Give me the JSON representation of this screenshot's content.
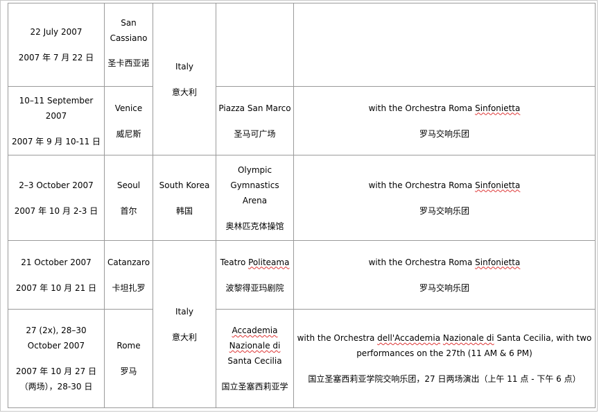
{
  "rows": [
    {
      "date_en": "22 July 2007",
      "date_zh": "2007 年 7 月 22 日",
      "city_en": "San Cassiano",
      "city_zh": "圣卡西亚诺",
      "venue_en": "",
      "venue_zh": "",
      "note_en": "",
      "note_zh": ""
    },
    {
      "date_en": "10–11 September 2007",
      "date_zh": "2007 年 9 月 10-11 日",
      "city_en": "Venice",
      "city_zh": "威尼斯",
      "venue_en": "Piazza San Marco",
      "venue_zh": "圣马可广场",
      "note_en_pre": "with the Orchestra Roma ",
      "note_en_sq": "Sinfonietta",
      "note_zh": "罗马交响乐团"
    },
    {
      "date_en": "2–3 October 2007",
      "date_zh": "2007 年 10 月 2-3 日",
      "city_en": "Seoul",
      "city_zh": "首尔",
      "venue_en": "Olympic Gymnastics Arena",
      "venue_zh": "奥林匹克体操馆",
      "note_en_pre": "with the Orchestra Roma ",
      "note_en_sq": "Sinfonietta",
      "note_zh": "罗马交响乐团"
    },
    {
      "date_en": "21 October 2007",
      "date_zh": "2007 年 10 月 21 日",
      "city_en": "Catanzaro",
      "city_zh": "卡坦扎罗",
      "venue_en_pre": "Teatro ",
      "venue_en_sq": "Politeama",
      "venue_zh": "波黎得亚玛剧院",
      "note_en_pre": "with the Orchestra Roma ",
      "note_en_sq": "Sinfonietta",
      "note_zh": "罗马交响乐团"
    },
    {
      "date_en": "27 (2x), 28–30 October 2007",
      "date_zh": "2007 年 10 月 27 日（两场），28-30 日",
      "city_en": "Rome",
      "city_zh": "罗马",
      "venue_en_sq1": "Accademia",
      "venue_en_sq2": "Nazionale di",
      "venue_en_post": " Santa Cecilia",
      "venue_zh": "国立圣塞西莉亚学",
      "note_en_pre": "with the Orchestra ",
      "note_en_sq1": "dell'Accademia",
      "note_en_mid1": " ",
      "note_en_sq2": "Nazionale di",
      "note_en_post": " Santa Cecilia, with two performances on the 27th (11 AM & 6 PM)",
      "note_zh": "国立圣塞西莉亚学院交响乐团，27 日两场演出（上午 11 点 - 下午 6 点）"
    }
  ],
  "countries": {
    "italy_en": "Italy",
    "italy_zh": "意大利",
    "korea_en": "South Korea",
    "korea_zh": "韩国",
    "italy2_en": "Italy",
    "italy2_zh": "意大利"
  }
}
